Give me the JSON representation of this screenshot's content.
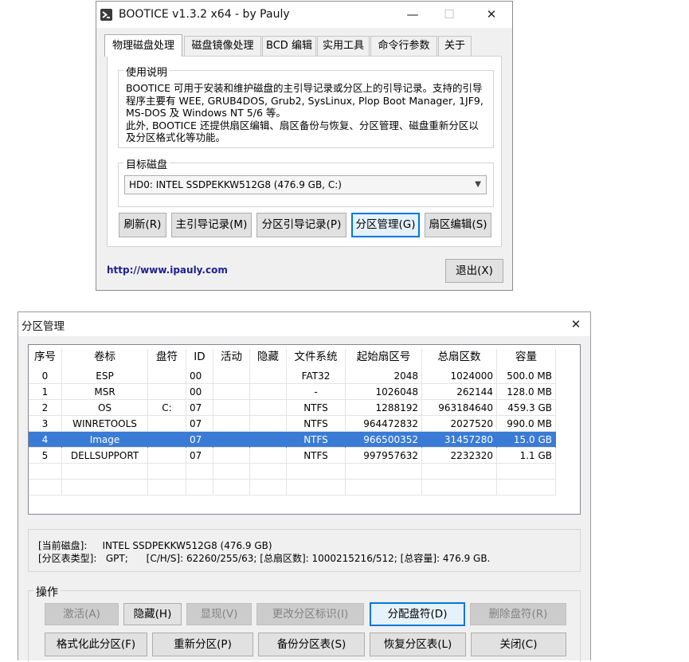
{
  "bootice": {
    "title": "BOOTICE v1.3.2 x64 - by Pauly",
    "caption": {
      "minimize": "—",
      "maximize": "☐",
      "close": "✕"
    },
    "tabs": [
      "物理磁盘处理",
      "磁盘镜像处理",
      "BCD 编辑",
      "实用工具",
      "命令行参数",
      "关于"
    ],
    "usage": {
      "title": "使用说明",
      "text": "BOOTICE 可用于安装和维护磁盘的主引导记录或分区上的引导记录。支持的引导程序主要有 WEE, GRUB4DOS, Grub2, SysLinux, Plop Boot Manager, 1JF9, MS-DOS 及 Windows NT 5/6 等。\n此外, BOOTICE 还提供扇区编辑、扇区备份与恢复、分区管理、磁盘重新分区以及分区格式化等功能。"
    },
    "target_disk": {
      "title": "目标磁盘",
      "selected": "HD0: INTEL SSDPEKKW512G8 (476.9 GB, C:)"
    },
    "buttons": {
      "refresh": "刷新(R)",
      "mbr": "主引导记录(M)",
      "pbr": "分区引导记录(P)",
      "parts": "分区管理(G)",
      "sector": "扇区编辑(S)",
      "exit": "退出(X)"
    },
    "link": "http://www.ipauly.com"
  },
  "partition_manager": {
    "title": "分区管理",
    "close": "✕",
    "columns": [
      "序号",
      "卷标",
      "盘符",
      "ID",
      "活动",
      "隐藏",
      "文件系统",
      "起始扇区号",
      "总扇区数",
      "容量"
    ],
    "rows": [
      {
        "cells": [
          "0",
          "ESP",
          "",
          "00",
          "",
          "",
          "FAT32",
          "2048",
          "1024000",
          "500.0 MB"
        ]
      },
      {
        "cells": [
          "1",
          "MSR",
          "",
          "00",
          "",
          "",
          "-",
          "1026048",
          "262144",
          "128.0 MB"
        ]
      },
      {
        "cells": [
          "2",
          "OS",
          "C:",
          "07",
          "",
          "",
          "NTFS",
          "1288192",
          "963184640",
          "459.3 GB"
        ]
      },
      {
        "cells": [
          "3",
          "WINRETOOLS",
          "",
          "07",
          "",
          "",
          "NTFS",
          "964472832",
          "2027520",
          "990.0 MB"
        ]
      },
      {
        "cells": [
          "4",
          "Image",
          "",
          "07",
          "",
          "",
          "NTFS",
          "966500352",
          "31457280",
          "15.0 GB"
        ]
      },
      {
        "cells": [
          "5",
          "DELLSUPPORT",
          "",
          "07",
          "",
          "",
          "NTFS",
          "997957632",
          "2232320",
          "1.1 GB"
        ]
      }
    ],
    "selected_row": 4,
    "info": {
      "line1": "[当前磁盘]:     INTEL SSDPEKKW512G8 (476.9 GB)",
      "line2": "[分区表类型]:   GPT;      [C/H/S]: 62260/255/63; [总扇区数]: 1000215216/512; [总容量]: 476.9 GB."
    },
    "ops": {
      "title": "操作",
      "activate": "激活(A)",
      "hide": "隐藏(H)",
      "show": "显现(V)",
      "change_id": "更改分区标识(I)",
      "assign": "分配盘符(D)",
      "remove_letter": "删除盘符(R)",
      "format": "格式化此分区(F)",
      "repartition": "重新分区(P)",
      "backup": "备份分区表(S)",
      "restore": "恢复分区表(L)",
      "close_btn": "关闭(C)"
    }
  },
  "colors": {
    "accent": "#0078d7",
    "selected_row": "#3a7bd5",
    "link": "#1f1f8f"
  }
}
